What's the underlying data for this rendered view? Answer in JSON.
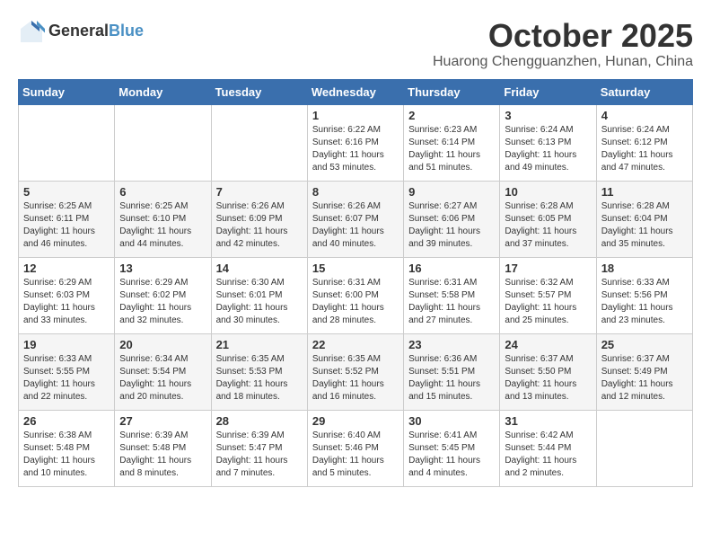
{
  "header": {
    "logo_general": "General",
    "logo_blue": "Blue",
    "month_title": "October 2025",
    "location": "Huarong Chengguanzhen, Hunan, China"
  },
  "days_of_week": [
    "Sunday",
    "Monday",
    "Tuesday",
    "Wednesday",
    "Thursday",
    "Friday",
    "Saturday"
  ],
  "weeks": [
    [
      {
        "day": "",
        "info": ""
      },
      {
        "day": "",
        "info": ""
      },
      {
        "day": "",
        "info": ""
      },
      {
        "day": "1",
        "info": "Sunrise: 6:22 AM\nSunset: 6:16 PM\nDaylight: 11 hours\nand 53 minutes."
      },
      {
        "day": "2",
        "info": "Sunrise: 6:23 AM\nSunset: 6:14 PM\nDaylight: 11 hours\nand 51 minutes."
      },
      {
        "day": "3",
        "info": "Sunrise: 6:24 AM\nSunset: 6:13 PM\nDaylight: 11 hours\nand 49 minutes."
      },
      {
        "day": "4",
        "info": "Sunrise: 6:24 AM\nSunset: 6:12 PM\nDaylight: 11 hours\nand 47 minutes."
      }
    ],
    [
      {
        "day": "5",
        "info": "Sunrise: 6:25 AM\nSunset: 6:11 PM\nDaylight: 11 hours\nand 46 minutes."
      },
      {
        "day": "6",
        "info": "Sunrise: 6:25 AM\nSunset: 6:10 PM\nDaylight: 11 hours\nand 44 minutes."
      },
      {
        "day": "7",
        "info": "Sunrise: 6:26 AM\nSunset: 6:09 PM\nDaylight: 11 hours\nand 42 minutes."
      },
      {
        "day": "8",
        "info": "Sunrise: 6:26 AM\nSunset: 6:07 PM\nDaylight: 11 hours\nand 40 minutes."
      },
      {
        "day": "9",
        "info": "Sunrise: 6:27 AM\nSunset: 6:06 PM\nDaylight: 11 hours\nand 39 minutes."
      },
      {
        "day": "10",
        "info": "Sunrise: 6:28 AM\nSunset: 6:05 PM\nDaylight: 11 hours\nand 37 minutes."
      },
      {
        "day": "11",
        "info": "Sunrise: 6:28 AM\nSunset: 6:04 PM\nDaylight: 11 hours\nand 35 minutes."
      }
    ],
    [
      {
        "day": "12",
        "info": "Sunrise: 6:29 AM\nSunset: 6:03 PM\nDaylight: 11 hours\nand 33 minutes."
      },
      {
        "day": "13",
        "info": "Sunrise: 6:29 AM\nSunset: 6:02 PM\nDaylight: 11 hours\nand 32 minutes."
      },
      {
        "day": "14",
        "info": "Sunrise: 6:30 AM\nSunset: 6:01 PM\nDaylight: 11 hours\nand 30 minutes."
      },
      {
        "day": "15",
        "info": "Sunrise: 6:31 AM\nSunset: 6:00 PM\nDaylight: 11 hours\nand 28 minutes."
      },
      {
        "day": "16",
        "info": "Sunrise: 6:31 AM\nSunset: 5:58 PM\nDaylight: 11 hours\nand 27 minutes."
      },
      {
        "day": "17",
        "info": "Sunrise: 6:32 AM\nSunset: 5:57 PM\nDaylight: 11 hours\nand 25 minutes."
      },
      {
        "day": "18",
        "info": "Sunrise: 6:33 AM\nSunset: 5:56 PM\nDaylight: 11 hours\nand 23 minutes."
      }
    ],
    [
      {
        "day": "19",
        "info": "Sunrise: 6:33 AM\nSunset: 5:55 PM\nDaylight: 11 hours\nand 22 minutes."
      },
      {
        "day": "20",
        "info": "Sunrise: 6:34 AM\nSunset: 5:54 PM\nDaylight: 11 hours\nand 20 minutes."
      },
      {
        "day": "21",
        "info": "Sunrise: 6:35 AM\nSunset: 5:53 PM\nDaylight: 11 hours\nand 18 minutes."
      },
      {
        "day": "22",
        "info": "Sunrise: 6:35 AM\nSunset: 5:52 PM\nDaylight: 11 hours\nand 16 minutes."
      },
      {
        "day": "23",
        "info": "Sunrise: 6:36 AM\nSunset: 5:51 PM\nDaylight: 11 hours\nand 15 minutes."
      },
      {
        "day": "24",
        "info": "Sunrise: 6:37 AM\nSunset: 5:50 PM\nDaylight: 11 hours\nand 13 minutes."
      },
      {
        "day": "25",
        "info": "Sunrise: 6:37 AM\nSunset: 5:49 PM\nDaylight: 11 hours\nand 12 minutes."
      }
    ],
    [
      {
        "day": "26",
        "info": "Sunrise: 6:38 AM\nSunset: 5:48 PM\nDaylight: 11 hours\nand 10 minutes."
      },
      {
        "day": "27",
        "info": "Sunrise: 6:39 AM\nSunset: 5:48 PM\nDaylight: 11 hours\nand 8 minutes."
      },
      {
        "day": "28",
        "info": "Sunrise: 6:39 AM\nSunset: 5:47 PM\nDaylight: 11 hours\nand 7 minutes."
      },
      {
        "day": "29",
        "info": "Sunrise: 6:40 AM\nSunset: 5:46 PM\nDaylight: 11 hours\nand 5 minutes."
      },
      {
        "day": "30",
        "info": "Sunrise: 6:41 AM\nSunset: 5:45 PM\nDaylight: 11 hours\nand 4 minutes."
      },
      {
        "day": "31",
        "info": "Sunrise: 6:42 AM\nSunset: 5:44 PM\nDaylight: 11 hours\nand 2 minutes."
      },
      {
        "day": "",
        "info": ""
      }
    ]
  ]
}
